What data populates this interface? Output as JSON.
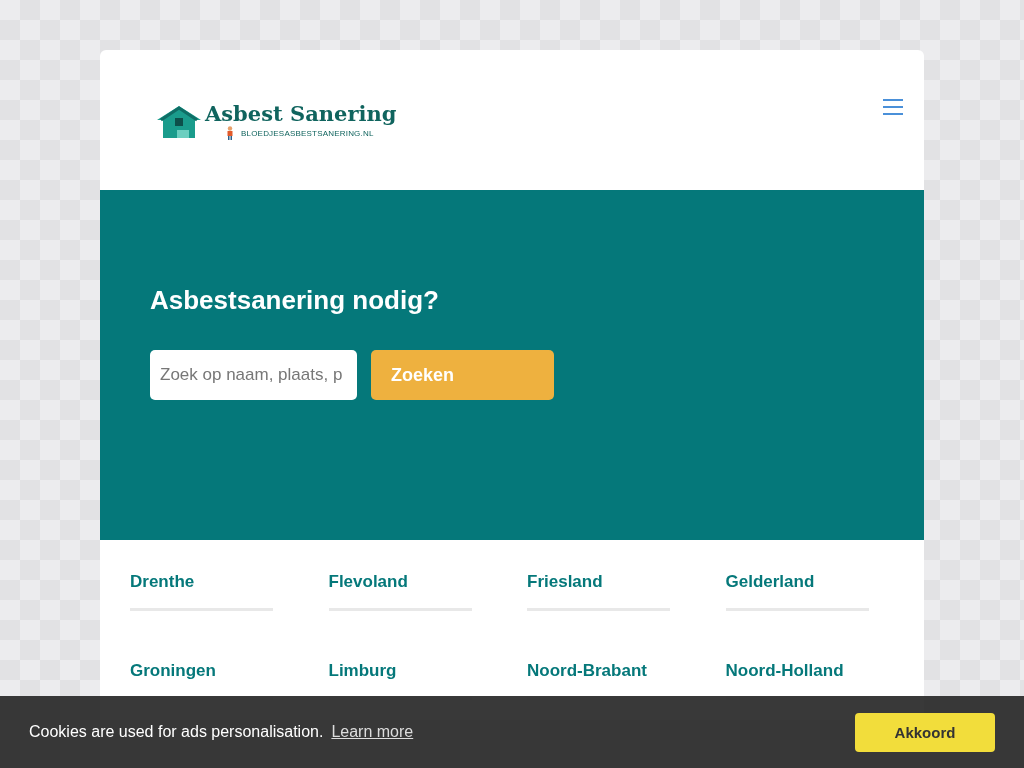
{
  "header": {
    "logo_title": "Asbest Sanering",
    "logo_subtitle": "BLOEDJESASBESTSANERING.NL"
  },
  "hero": {
    "title": "Asbestsanering nodig?",
    "search": {
      "placeholder": "Zoek op naam, plaats, p"
    },
    "button": "Zoeken"
  },
  "provinces": [
    "Drenthe",
    "Flevoland",
    "Friesland",
    "Gelderland",
    "Groningen",
    "Limburg",
    "Noord-Brabant",
    "Noord-Holland"
  ],
  "cookie_bar": {
    "text": "Cookies are used for ads personalisation.",
    "link": "Learn more",
    "button": "Akkoord"
  }
}
